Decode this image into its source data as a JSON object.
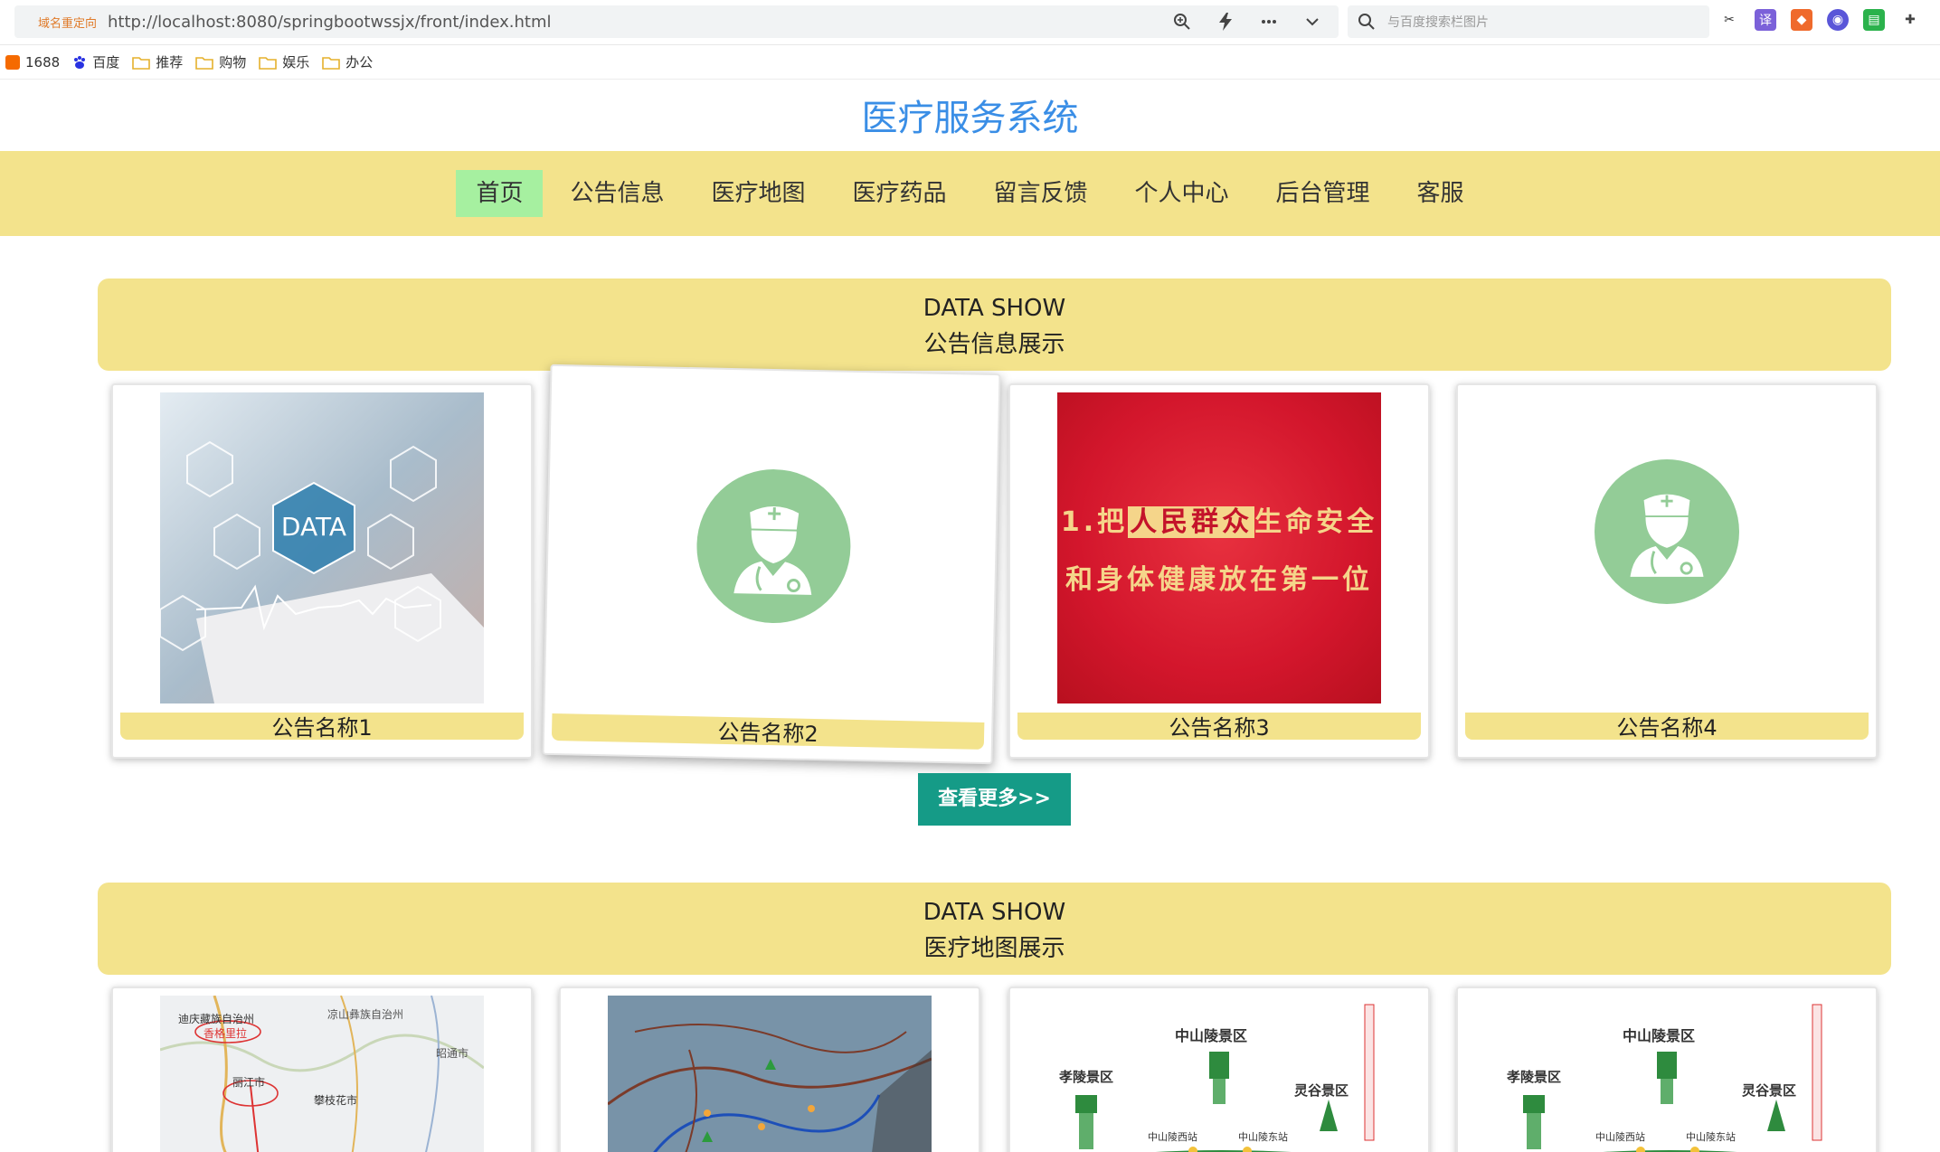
{
  "browser": {
    "redirect_tag": "域名重定向",
    "url": "http://localhost:8080/springbootwssjx/front/index.html",
    "search_placeholder": "与百度搜索栏图片"
  },
  "bookmarks": [
    {
      "label": "1688",
      "icon": "1688-icon"
    },
    {
      "label": "百度",
      "icon": "baidu-icon"
    },
    {
      "label": "推荐",
      "icon": "folder-icon"
    },
    {
      "label": "购物",
      "icon": "folder-icon"
    },
    {
      "label": "娱乐",
      "icon": "folder-icon"
    },
    {
      "label": "办公",
      "icon": "folder-icon"
    }
  ],
  "site": {
    "title": "医疗服务系统"
  },
  "nav": [
    {
      "label": "首页",
      "active": true
    },
    {
      "label": "公告信息"
    },
    {
      "label": "医疗地图"
    },
    {
      "label": "医疗药品"
    },
    {
      "label": "留言反馈"
    },
    {
      "label": "个人中心"
    },
    {
      "label": "后台管理"
    },
    {
      "label": "客服"
    }
  ],
  "sections": [
    {
      "en": "DATA SHOW",
      "cn": "公告信息展示",
      "cards": [
        {
          "label": "公告名称1",
          "image": "data-keyboard-photo"
        },
        {
          "label": "公告名称2",
          "image": "doctor-avatar"
        },
        {
          "label": "公告名称3",
          "image": "red-slogan-poster",
          "lines": [
            "1.把人民群众生命安全",
            "和身体健康放在第一位"
          ],
          "highlight": "人民群众"
        },
        {
          "label": "公告名称4",
          "image": "doctor-avatar"
        }
      ],
      "more_button": "查看更多>>"
    },
    {
      "en": "DATA SHOW",
      "cn": "医疗地图展示",
      "cards": [
        {
          "image": "road-map",
          "map_texts": [
            "迪庆藏族自治州",
            "香格里拉",
            "凉山彝族自治州",
            "昭通市",
            "丽江市",
            "攀枝花市"
          ]
        },
        {
          "image": "scenic-map"
        },
        {
          "image": "station-map",
          "map_texts": [
            "中山陵景区",
            "孝陵景区",
            "灵谷景区",
            "中山陵西站",
            "中山陵东站"
          ]
        },
        {
          "image": "station-map",
          "map_texts": [
            "中山陵景区",
            "孝陵景区",
            "灵谷景区",
            "中山陵西站",
            "中山陵东站"
          ]
        }
      ]
    }
  ],
  "colors": {
    "accent_yellow": "#f3e38c",
    "active_green": "#a6f0a0",
    "title_blue": "#3a8ee6",
    "button_teal": "#159b87",
    "avatar_green": "#93cc97"
  }
}
